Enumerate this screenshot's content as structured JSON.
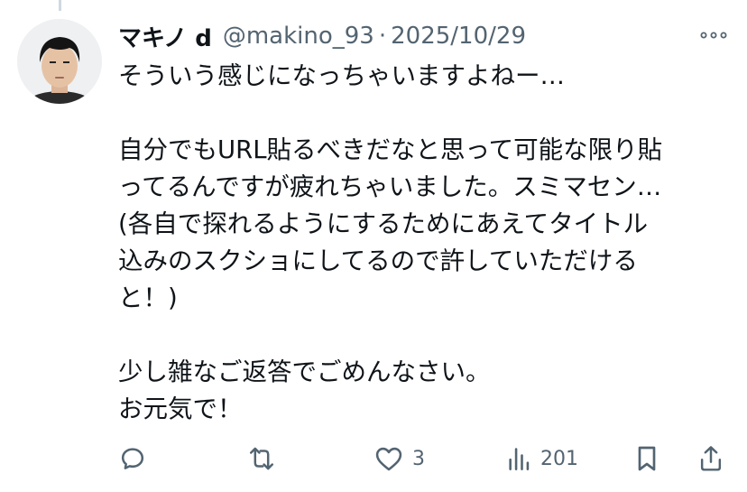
{
  "tweet": {
    "author": {
      "name": "マキノ d",
      "handle": "@makino_93",
      "separator": "·",
      "date": "2025/10/29"
    },
    "lines": [
      "そういう感じになっちゃいますよねー…",
      "",
      "自分でもURL貼るべきだなと思って可能な限り貼",
      "ってるんですが疲れちゃいました。スミマセン…",
      "(各自で探れるようにするためにあえてタイトル",
      "込みのスクショにしてるので許していただける",
      "と！)",
      "",
      "少し雑なご返答でごめんなさい。",
      "お元気で！"
    ],
    "stats": {
      "likes": "3",
      "views": "201"
    }
  },
  "icons": {
    "more": "more-horizontal-icon",
    "reply": "reply-icon",
    "retweet": "retweet-icon",
    "like": "heart-icon",
    "views": "views-bar-icon",
    "bookmark": "bookmark-icon",
    "share": "share-icon"
  },
  "colors": {
    "text": "#0f1419",
    "secondary": "#536471",
    "thread_line": "#cfd9de"
  }
}
